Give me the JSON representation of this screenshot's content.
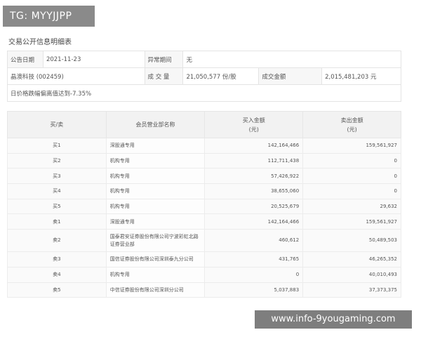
{
  "badge": "TG: MYYJJPP",
  "title": "交易公开信息明细表",
  "info": {
    "announce_label": "公告日期",
    "announce_value": "2021-11-23",
    "abnormal_label": "异常期间",
    "abnormal_value": "无",
    "stock_name": "晶澳科技 (002459)",
    "volume_label": "成 交 量",
    "volume_value": "21,050,577 份/股",
    "amount_label": "成交金额",
    "amount_value": "2,015,481,203 元",
    "reason": "日价格跌幅偏离值达到-7.35%"
  },
  "table": {
    "headers": {
      "side": "买/卖",
      "seat": "会员营业部名称",
      "buy_line1": "买入金额",
      "buy_line2": "(元)",
      "sell_line1": "卖出金额",
      "sell_line2": "(元)"
    },
    "rows": [
      {
        "side": "买1",
        "seat": "深股通专用",
        "buy": "142,164,466",
        "sell": "159,561,927"
      },
      {
        "side": "买2",
        "seat": "机构专用",
        "buy": "112,711,438",
        "sell": "0"
      },
      {
        "side": "买3",
        "seat": "机构专用",
        "buy": "57,426,922",
        "sell": "0"
      },
      {
        "side": "买4",
        "seat": "机构专用",
        "buy": "38,655,060",
        "sell": "0"
      },
      {
        "side": "买5",
        "seat": "机构专用",
        "buy": "20,525,679",
        "sell": "29,632"
      },
      {
        "side": "卖1",
        "seat": "深股通专用",
        "buy": "142,164,466",
        "sell": "159,561,927"
      },
      {
        "side": "卖2",
        "seat": "国泰君安证券股份有限公司宁波彩虹北路证券营业部",
        "buy": "460,612",
        "sell": "50,489,503"
      },
      {
        "side": "卖3",
        "seat": "国信证券股份有限公司深圳泰九分公司",
        "buy": "431,765",
        "sell": "46,265,352"
      },
      {
        "side": "卖4",
        "seat": "机构专用",
        "buy": "0",
        "sell": "40,010,493"
      },
      {
        "side": "卖5",
        "seat": "中信证券股份有限公司深圳分公司",
        "buy": "5,037,883",
        "sell": "37,373,375"
      }
    ]
  },
  "watermark": "www.info-9yougaming.com"
}
